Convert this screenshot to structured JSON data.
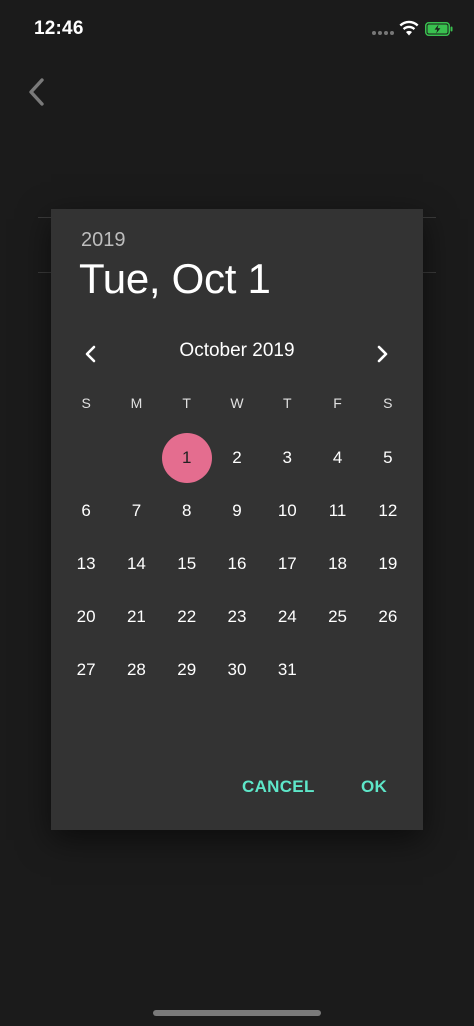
{
  "status_bar": {
    "time": "12:46"
  },
  "dialog": {
    "year": "2019",
    "selected_date": "Tue, Oct 1",
    "month_label": "October 2019",
    "weekdays": [
      "S",
      "M",
      "T",
      "W",
      "T",
      "F",
      "S"
    ],
    "days": [
      "1",
      "2",
      "3",
      "4",
      "5",
      "6",
      "7",
      "8",
      "9",
      "10",
      "11",
      "12",
      "13",
      "14",
      "15",
      "16",
      "17",
      "18",
      "19",
      "20",
      "21",
      "22",
      "23",
      "24",
      "25",
      "26",
      "27",
      "28",
      "29",
      "30",
      "31"
    ],
    "selected_day": "1",
    "cancel_label": "CANCEL",
    "ok_label": "OK"
  },
  "colors": {
    "accent": "#5ee7c9",
    "selection": "#e46d8f",
    "dialog_bg": "#333333",
    "page_bg": "#1b1b1b"
  },
  "icons": {
    "back": "chevron-left-icon",
    "prev_month": "chevron-left-icon",
    "next_month": "chevron-right-icon",
    "wifi": "wifi-icon",
    "battery": "battery-charging-icon",
    "signal": "cellular-signal-icon"
  }
}
